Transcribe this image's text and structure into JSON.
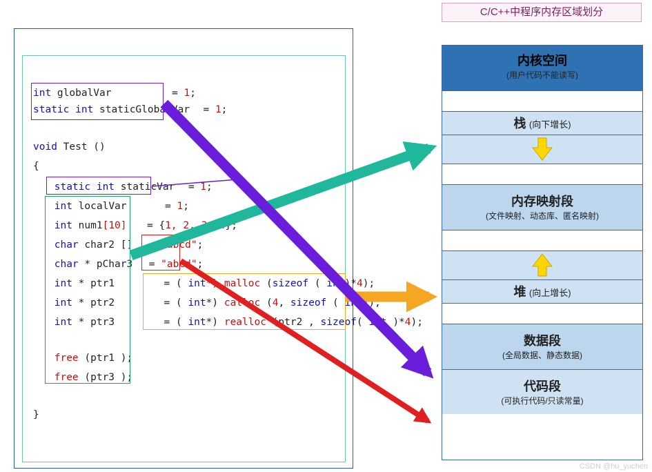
{
  "title": "C/C++中程序内存区域划分",
  "watermark": "CSDN @hu_yuchen",
  "code": {
    "l1_pre": "int",
    "l1_mid": " globalVar",
    "l1_eq": "= ",
    "l1_val": "1",
    "l1_end": ";",
    "l2_pre": "static int",
    "l2_mid": " staticGlobalVar",
    "l2_eq": "= ",
    "l2_val": "1",
    "l2_end": ";",
    "l3_pre": "void",
    "l3_mid": " Test ()",
    "l4": "{",
    "l5_pre": "static int",
    "l5_mid": " staticVar",
    "l5_eq": "= ",
    "l5_val": "1",
    "l5_end": ";",
    "l6_pre": "int",
    "l6_mid": " localVar",
    "l6_eq": "= ",
    "l6_val": "1",
    "l6_end": ";",
    "l7_pre": "int",
    "l7_mid": " num1",
    "l7_br": "[10]",
    "l7_eq": "= {",
    "l7_val": "1, 2, 3, 4",
    "l7_end": "};",
    "l8_pre": "char",
    "l8_mid": " char2 []",
    "l8_eq": " = ",
    "l8_val": "\"abcd\"",
    "l8_end": ";",
    "l9_pre": "char",
    "l9_mid": " * pChar3",
    "l9_eq": "= ",
    "l9_val": "\"abcd\"",
    "l9_end": ";",
    "l10_pre": "int",
    "l10_mid": " * ptr1",
    "l10_eq": "= ( ",
    "l10_cast": "int",
    "l10_cast2": "*) ",
    "l10_fn": "malloc",
    "l10_rest1": " (",
    "l10_sz": "sizeof",
    "l10_rest2": " ( ",
    "l10_ty": "int",
    "l10_rest3": ")*",
    "l10_num": "4",
    "l10_rest4": ");",
    "l11_pre": "int",
    "l11_mid": " * ptr2",
    "l11_eq": "= ( ",
    "l11_cast": "int",
    "l11_cast2": "*) ",
    "l11_fn": "calloc",
    "l11_rest1": " (",
    "l11_num": "4",
    "l11_rest2": ", ",
    "l11_sz": "sizeof",
    "l11_rest3": " ( ",
    "l11_ty": "int",
    "l11_rest4": "));",
    "l12_pre": "int",
    "l12_mid": " * ptr3",
    "l12_eq": "= ( ",
    "l12_cast": "int",
    "l12_cast2": "*) ",
    "l12_fn": "realloc",
    "l12_rest1": " (ptr2 , ",
    "l12_sz": "sizeof",
    "l12_rest2": "( ",
    "l12_ty": "int",
    "l12_rest3": " )*",
    "l12_num": "4",
    "l12_rest4": ");",
    "l13_fn": "free",
    "l13_mid": " (ptr1 );",
    "l14_fn": "free",
    "l14_mid": " (ptr3 );",
    "l15": "}"
  },
  "mem": {
    "kernel_t": "内核空间",
    "kernel_s": "(用户代码不能读写)",
    "stack_t": "栈",
    "stack_s": "(向下增长)",
    "mmap_t": "内存映射段",
    "mmap_s": "(文件映射、动态库、匿名映射)",
    "heap_t": "堆",
    "heap_s": "(向上增长)",
    "data_t": "数据段",
    "data_s": "(全局数据、静态数据)",
    "text_t": "代码段",
    "text_s": "(可执行代码/只读常量)"
  },
  "colors": {
    "teal": "#1fb89c",
    "orange": "#f5a623",
    "purple": "#6a1edb",
    "red": "#e02020",
    "yellow": "#ffd600",
    "darkHeader": "#2f72b3",
    "light": "#cfe2f3",
    "midLight": "#bcd6ee"
  }
}
